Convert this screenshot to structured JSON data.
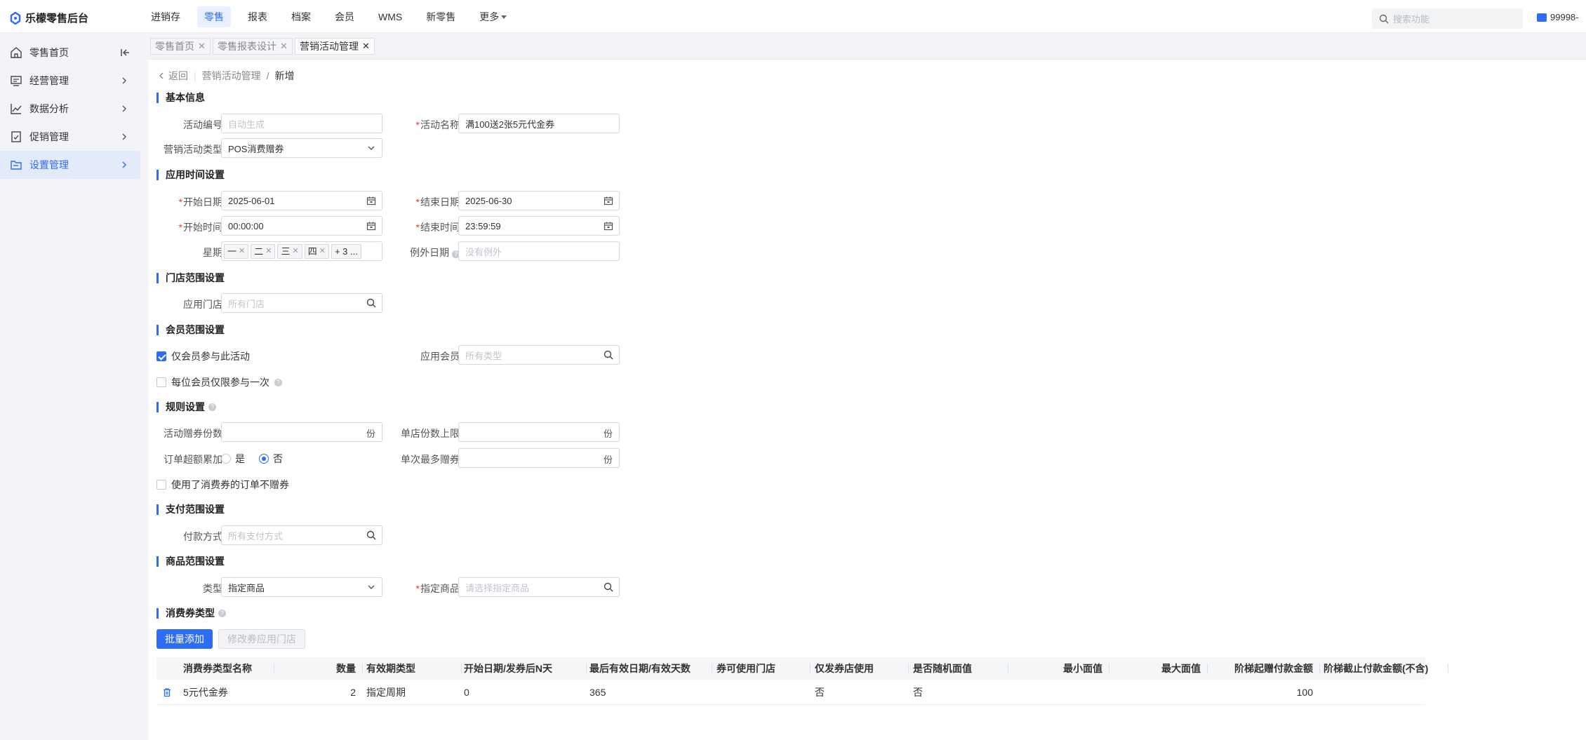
{
  "app": {
    "title": "乐檬零售后台",
    "user": "99998-"
  },
  "topnav": [
    {
      "label": "进销存",
      "active": false
    },
    {
      "label": "零售",
      "active": true
    },
    {
      "label": "报表",
      "active": false
    },
    {
      "label": "档案",
      "active": false
    },
    {
      "label": "会员",
      "active": false
    },
    {
      "label": "WMS",
      "active": false
    },
    {
      "label": "新零售",
      "active": false
    },
    {
      "label": "更多",
      "active": false
    }
  ],
  "search": {
    "placeholder": "搜索功能"
  },
  "sidebar": {
    "items": [
      {
        "label": "零售首页",
        "icon": "home-icon"
      },
      {
        "label": "经营管理",
        "icon": "monitor-icon"
      },
      {
        "label": "数据分析",
        "icon": "chart-line-icon"
      },
      {
        "label": "促销管理",
        "icon": "promo-icon"
      },
      {
        "label": "设置管理",
        "icon": "folder-icon",
        "active": true
      }
    ]
  },
  "tabs": [
    {
      "label": "零售首页"
    },
    {
      "label": "零售报表设计"
    },
    {
      "label": "营销活动管理",
      "active": true
    }
  ],
  "breadcrumb": {
    "back": "返回",
    "parent": "营销活动管理",
    "current": "新增"
  },
  "sections": {
    "basic": "基本信息",
    "time": "应用时间设置",
    "store": "门店范围设置",
    "member": "会员范围设置",
    "rules": "规则设置",
    "payment": "支付范围设置",
    "goods": "商品范围设置",
    "coupon": "消费券类型"
  },
  "form": {
    "activity_no": {
      "label": "活动编号",
      "placeholder": "自动生成"
    },
    "activity_name": {
      "label": "活动名称",
      "value": "满100送2张5元代金券"
    },
    "activity_type": {
      "label": "营销活动类型",
      "value": "POS消费赠券"
    },
    "start_date": {
      "label": "开始日期",
      "value": "2025-06-01"
    },
    "end_date": {
      "label": "结束日期",
      "value": "2025-06-30"
    },
    "start_time": {
      "label": "开始时间",
      "value": "00:00:00"
    },
    "end_time": {
      "label": "结束时间",
      "value": "23:59:59"
    },
    "weekdays": {
      "label": "星期",
      "tags": [
        "一",
        "二",
        "三",
        "四"
      ],
      "more": "+ 3 ..."
    },
    "exception_date": {
      "label": "例外日期",
      "placeholder": "没有例外"
    },
    "stores": {
      "label": "应用门店",
      "placeholder": "所有门店"
    },
    "member_only": {
      "label": "仅会员参与此活动",
      "checked": true
    },
    "member_types": {
      "label": "应用会员",
      "placeholder": "所有类型"
    },
    "once_per_member": {
      "label": "每位会员仅限参与一次",
      "checked": false
    },
    "coupon_count": {
      "label": "活动赠券份数",
      "unit": "份"
    },
    "store_limit": {
      "label": "单店份数上限",
      "unit": "份"
    },
    "accumulate": {
      "label": "订单超额累加",
      "options": [
        "是",
        "否"
      ],
      "selected": "否"
    },
    "max_per_order": {
      "label": "单次最多赠券",
      "unit": "份"
    },
    "no_coupon_if_used": {
      "label": "使用了消费券的订单不赠券",
      "checked": false
    },
    "payment_methods": {
      "label": "付款方式",
      "placeholder": "所有支付方式"
    },
    "goods_type": {
      "label": "类型",
      "value": "指定商品"
    },
    "goods": {
      "label": "指定商品",
      "placeholder": "请选择指定商品"
    }
  },
  "buttons": {
    "batch_add": "批量添加",
    "edit_stores": "修改券应用门店"
  },
  "table": {
    "columns": [
      "消费券类型名称",
      "数量",
      "有效期类型",
      "开始日期/发券后N天",
      "最后有效日期/有效天数",
      "券可使用门店",
      "仅发券店使用",
      "是否随机面值",
      "最小面值",
      "最大面值",
      "阶梯起赠付款金额",
      "阶梯截止付款金额(不含)"
    ],
    "rows": [
      {
        "name": "5元代金券",
        "qty": "2",
        "validity_type": "指定周期",
        "start": "0",
        "end": "365",
        "stores": "",
        "issue_store_only": "否",
        "random_value": "否",
        "min_value": "",
        "max_value": "",
        "tier_start": "100",
        "tier_end": ""
      }
    ]
  },
  "colors": {
    "accent": "#2d6cf6",
    "required": "#e53935",
    "sidebar_bg": "#f3f4f7"
  }
}
